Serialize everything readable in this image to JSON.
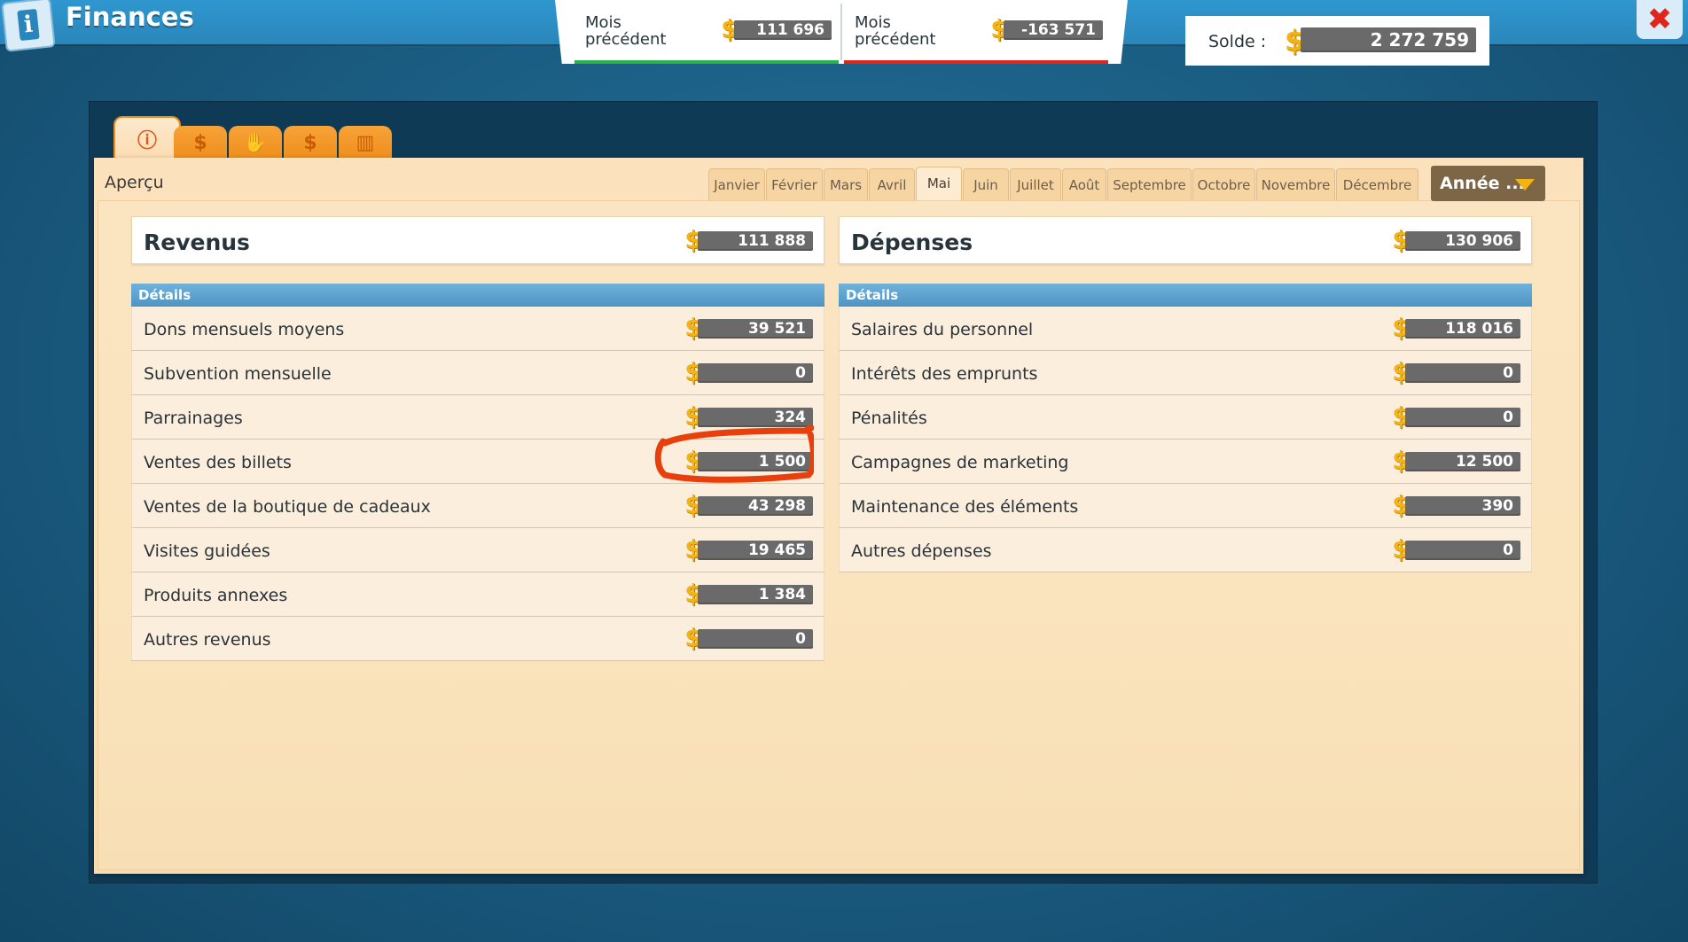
{
  "header": {
    "title": "Finances",
    "info_icon": "info-icon",
    "close_icon": "close-icon"
  },
  "previous_month": {
    "income": {
      "label": "Mois précédent",
      "value": "111 696",
      "accent": "#2bb34a"
    },
    "expenses": {
      "label": "Mois précédent",
      "value": "-163 571",
      "accent": "#e1251b"
    }
  },
  "balance": {
    "label": "Solde :",
    "value": "2 272 759"
  },
  "tabs": [
    {
      "icon": "info-icon",
      "glyph": "ⓘ"
    },
    {
      "icon": "money-bag-icon",
      "glyph": "💰"
    },
    {
      "icon": "handshake-icon",
      "glyph": "🤝"
    },
    {
      "icon": "dollar-icon",
      "glyph": "$"
    },
    {
      "icon": "chart-icon",
      "glyph": "▥"
    }
  ],
  "section": {
    "label": "Aperçu"
  },
  "months": [
    "Janvier",
    "Février",
    "Mars",
    "Avril",
    "Mai",
    "Juin",
    "Juillet",
    "Août",
    "Septembre",
    "Octobre",
    "Novembre",
    "Décembre"
  ],
  "selected_month": "Mai",
  "year_button": {
    "label": "Année ..."
  },
  "revenue": {
    "title": "Revenus",
    "total": "111 888",
    "details_label": "Détails",
    "rows": [
      {
        "label": "Dons mensuels moyens",
        "value": "39 521"
      },
      {
        "label": "Subvention mensuelle",
        "value": "0"
      },
      {
        "label": "Parrainages",
        "value": "324"
      },
      {
        "label": "Ventes des billets",
        "value": "1 500"
      },
      {
        "label": "Ventes de la boutique de cadeaux",
        "value": "43 298"
      },
      {
        "label": "Visites guidées",
        "value": "19 465"
      },
      {
        "label": "Produits annexes",
        "value": "1 384"
      },
      {
        "label": "Autres revenus",
        "value": "0"
      }
    ]
  },
  "expenses": {
    "title": "Dépenses",
    "total": "130 906",
    "details_label": "Détails",
    "rows": [
      {
        "label": "Salaires du personnel",
        "value": "118 016"
      },
      {
        "label": "Intérêts des emprunts",
        "value": "0"
      },
      {
        "label": "Pénalités",
        "value": "0"
      },
      {
        "label": "Campagnes de marketing",
        "value": "12 500"
      },
      {
        "label": "Maintenance des éléments",
        "value": "390"
      },
      {
        "label": "Autres dépenses",
        "value": "0"
      }
    ]
  },
  "colors": {
    "coin": "#f4b315",
    "value_bar": "#6a6a6a",
    "details_bar": "#5aa1cf",
    "tab_orange": "#ef8d1c",
    "annotation": "#e8400c"
  },
  "annotation": {
    "target": "revenue.rows.3",
    "shape": "hand-drawn-circle"
  }
}
